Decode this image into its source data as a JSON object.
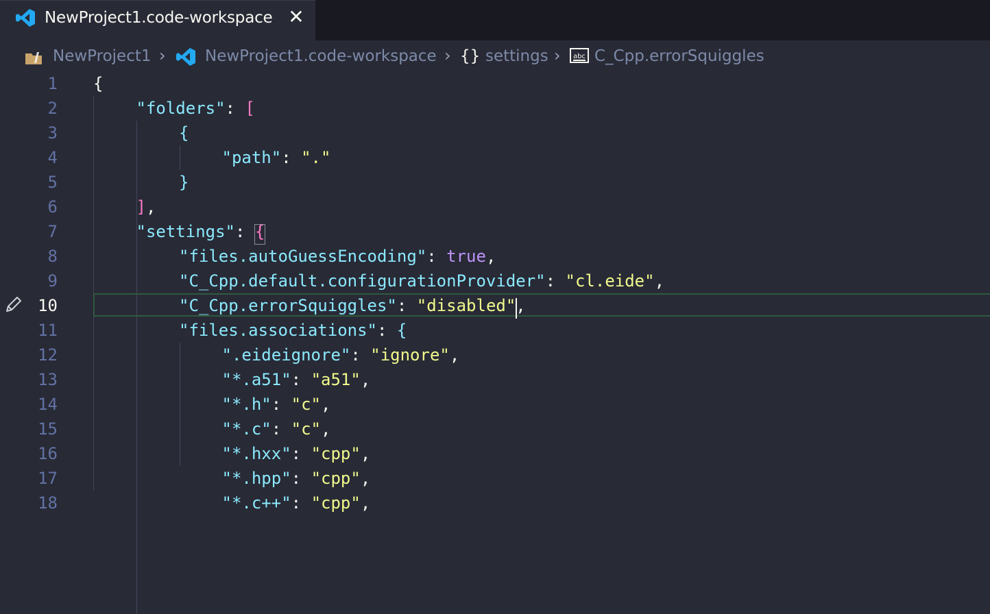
{
  "tab": {
    "title": "NewProject1.code-workspace",
    "close_glyph": "✕",
    "icon": "vscode-icon"
  },
  "breadcrumb": {
    "items": [
      "NewProject1",
      "NewProject1.code-workspace",
      "settings",
      "C_Cpp.errorSquiggles"
    ],
    "braces_glyph": "{}",
    "separator": "›"
  },
  "editor": {
    "active_line": 10,
    "lines": [
      {
        "n": "1"
      },
      {
        "n": "2"
      },
      {
        "n": "3"
      },
      {
        "n": "4"
      },
      {
        "n": "5"
      },
      {
        "n": "6"
      },
      {
        "n": "7"
      },
      {
        "n": "8"
      },
      {
        "n": "9"
      },
      {
        "n": "10"
      },
      {
        "n": "11"
      },
      {
        "n": "12"
      },
      {
        "n": "13"
      },
      {
        "n": "14"
      },
      {
        "n": "15"
      },
      {
        "n": "16"
      },
      {
        "n": "17"
      },
      {
        "n": "18"
      }
    ],
    "tokens": {
      "l1": [
        "{"
      ],
      "l2": [
        "\"folders\"",
        ": ",
        "["
      ],
      "l3": [
        "{"
      ],
      "l4": [
        "\"path\"",
        ": ",
        "\".\""
      ],
      "l5": [
        "}"
      ],
      "l6": [
        "]",
        ","
      ],
      "l7": [
        "\"settings\"",
        ": ",
        "{"
      ],
      "l8": [
        "\"files.autoGuessEncoding\"",
        ": ",
        "true",
        ","
      ],
      "l9": [
        "\"C_Cpp.default.configurationProvider\"",
        ": ",
        "\"cl.eide\"",
        ","
      ],
      "l10": [
        "\"C_Cpp.errorSquiggles\"",
        ": ",
        "\"disabled\"",
        ","
      ],
      "l11": [
        "\"files.associations\"",
        ": ",
        "{"
      ],
      "l12": [
        "\".eideignore\"",
        ": ",
        "\"ignore\"",
        ","
      ],
      "l13": [
        "\"*.a51\"",
        ": ",
        "\"a51\"",
        ","
      ],
      "l14": [
        "\"*.h\"",
        ": ",
        "\"c\"",
        ","
      ],
      "l15": [
        "\"*.c\"",
        ": ",
        "\"c\"",
        ","
      ],
      "l16": [
        "\"*.hxx\"",
        ": ",
        "\"cpp\"",
        ","
      ],
      "l17": [
        "\"*.hpp\"",
        ": ",
        "\"cpp\"",
        ","
      ],
      "l18": [
        "\"*.c++\"",
        ": ",
        "\"cpp\"",
        ","
      ]
    }
  },
  "colors": {
    "background": "#282a36",
    "tabbar": "#191a21",
    "key": "#8be9fd",
    "string": "#f1fa8c",
    "bracket": "#ff79c6",
    "boolean": "#bd93f9",
    "line_number": "#6272a4"
  }
}
